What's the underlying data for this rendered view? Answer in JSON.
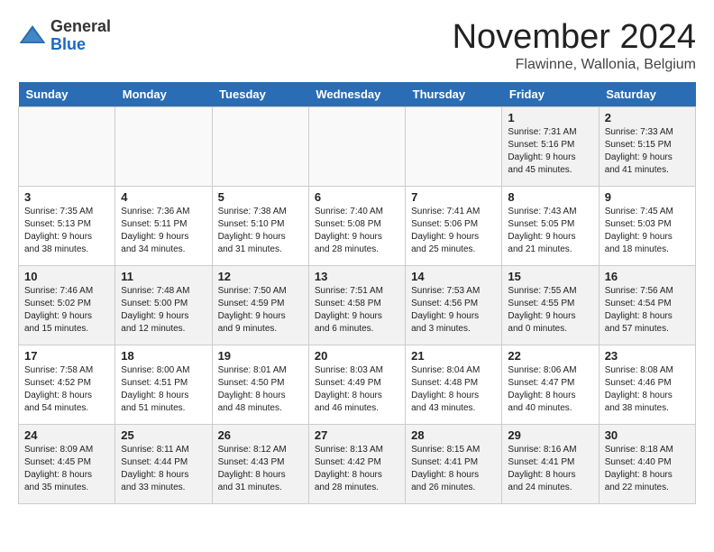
{
  "logo": {
    "general": "General",
    "blue": "Blue"
  },
  "title": "November 2024",
  "location": "Flawinne, Wallonia, Belgium",
  "weekdays": [
    "Sunday",
    "Monday",
    "Tuesday",
    "Wednesday",
    "Thursday",
    "Friday",
    "Saturday"
  ],
  "weeks": [
    [
      {
        "day": "",
        "info": ""
      },
      {
        "day": "",
        "info": ""
      },
      {
        "day": "",
        "info": ""
      },
      {
        "day": "",
        "info": ""
      },
      {
        "day": "",
        "info": ""
      },
      {
        "day": "1",
        "info": "Sunrise: 7:31 AM\nSunset: 5:16 PM\nDaylight: 9 hours and 45 minutes."
      },
      {
        "day": "2",
        "info": "Sunrise: 7:33 AM\nSunset: 5:15 PM\nDaylight: 9 hours and 41 minutes."
      }
    ],
    [
      {
        "day": "3",
        "info": "Sunrise: 7:35 AM\nSunset: 5:13 PM\nDaylight: 9 hours and 38 minutes."
      },
      {
        "day": "4",
        "info": "Sunrise: 7:36 AM\nSunset: 5:11 PM\nDaylight: 9 hours and 34 minutes."
      },
      {
        "day": "5",
        "info": "Sunrise: 7:38 AM\nSunset: 5:10 PM\nDaylight: 9 hours and 31 minutes."
      },
      {
        "day": "6",
        "info": "Sunrise: 7:40 AM\nSunset: 5:08 PM\nDaylight: 9 hours and 28 minutes."
      },
      {
        "day": "7",
        "info": "Sunrise: 7:41 AM\nSunset: 5:06 PM\nDaylight: 9 hours and 25 minutes."
      },
      {
        "day": "8",
        "info": "Sunrise: 7:43 AM\nSunset: 5:05 PM\nDaylight: 9 hours and 21 minutes."
      },
      {
        "day": "9",
        "info": "Sunrise: 7:45 AM\nSunset: 5:03 PM\nDaylight: 9 hours and 18 minutes."
      }
    ],
    [
      {
        "day": "10",
        "info": "Sunrise: 7:46 AM\nSunset: 5:02 PM\nDaylight: 9 hours and 15 minutes."
      },
      {
        "day": "11",
        "info": "Sunrise: 7:48 AM\nSunset: 5:00 PM\nDaylight: 9 hours and 12 minutes."
      },
      {
        "day": "12",
        "info": "Sunrise: 7:50 AM\nSunset: 4:59 PM\nDaylight: 9 hours and 9 minutes."
      },
      {
        "day": "13",
        "info": "Sunrise: 7:51 AM\nSunset: 4:58 PM\nDaylight: 9 hours and 6 minutes."
      },
      {
        "day": "14",
        "info": "Sunrise: 7:53 AM\nSunset: 4:56 PM\nDaylight: 9 hours and 3 minutes."
      },
      {
        "day": "15",
        "info": "Sunrise: 7:55 AM\nSunset: 4:55 PM\nDaylight: 9 hours and 0 minutes."
      },
      {
        "day": "16",
        "info": "Sunrise: 7:56 AM\nSunset: 4:54 PM\nDaylight: 8 hours and 57 minutes."
      }
    ],
    [
      {
        "day": "17",
        "info": "Sunrise: 7:58 AM\nSunset: 4:52 PM\nDaylight: 8 hours and 54 minutes."
      },
      {
        "day": "18",
        "info": "Sunrise: 8:00 AM\nSunset: 4:51 PM\nDaylight: 8 hours and 51 minutes."
      },
      {
        "day": "19",
        "info": "Sunrise: 8:01 AM\nSunset: 4:50 PM\nDaylight: 8 hours and 48 minutes."
      },
      {
        "day": "20",
        "info": "Sunrise: 8:03 AM\nSunset: 4:49 PM\nDaylight: 8 hours and 46 minutes."
      },
      {
        "day": "21",
        "info": "Sunrise: 8:04 AM\nSunset: 4:48 PM\nDaylight: 8 hours and 43 minutes."
      },
      {
        "day": "22",
        "info": "Sunrise: 8:06 AM\nSunset: 4:47 PM\nDaylight: 8 hours and 40 minutes."
      },
      {
        "day": "23",
        "info": "Sunrise: 8:08 AM\nSunset: 4:46 PM\nDaylight: 8 hours and 38 minutes."
      }
    ],
    [
      {
        "day": "24",
        "info": "Sunrise: 8:09 AM\nSunset: 4:45 PM\nDaylight: 8 hours and 35 minutes."
      },
      {
        "day": "25",
        "info": "Sunrise: 8:11 AM\nSunset: 4:44 PM\nDaylight: 8 hours and 33 minutes."
      },
      {
        "day": "26",
        "info": "Sunrise: 8:12 AM\nSunset: 4:43 PM\nDaylight: 8 hours and 31 minutes."
      },
      {
        "day": "27",
        "info": "Sunrise: 8:13 AM\nSunset: 4:42 PM\nDaylight: 8 hours and 28 minutes."
      },
      {
        "day": "28",
        "info": "Sunrise: 8:15 AM\nSunset: 4:41 PM\nDaylight: 8 hours and 26 minutes."
      },
      {
        "day": "29",
        "info": "Sunrise: 8:16 AM\nSunset: 4:41 PM\nDaylight: 8 hours and 24 minutes."
      },
      {
        "day": "30",
        "info": "Sunrise: 8:18 AM\nSunset: 4:40 PM\nDaylight: 8 hours and 22 minutes."
      }
    ]
  ]
}
